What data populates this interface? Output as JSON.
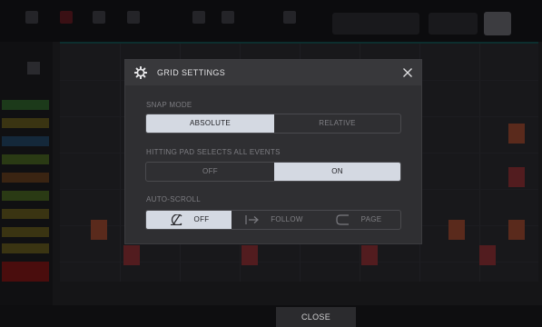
{
  "dialog": {
    "title": "GRID SETTINGS",
    "snap_mode": {
      "label": "SNAP MODE",
      "options": [
        "ABSOLUTE",
        "RELATIVE"
      ],
      "selected": "ABSOLUTE"
    },
    "hitting_pad": {
      "label": "HITTING PAD SELECTS ALL EVENTS",
      "options": [
        "OFF",
        "ON"
      ],
      "selected": "ON"
    },
    "auto_scroll": {
      "label": "AUTO-SCROLL",
      "options": [
        {
          "label": "OFF",
          "icon": "scroll-off-icon"
        },
        {
          "label": "FOLLOW",
          "icon": "follow-arrow-icon"
        },
        {
          "label": "PAGE",
          "icon": "page-icon"
        }
      ],
      "selected": "OFF"
    }
  },
  "footer": {
    "close_label": "CLOSE"
  },
  "colors": {
    "dialog_bg": "#2f2f32",
    "header_bg": "#38383b",
    "selected_bg": "#d4d9e2",
    "screen_bg": "#151517"
  }
}
